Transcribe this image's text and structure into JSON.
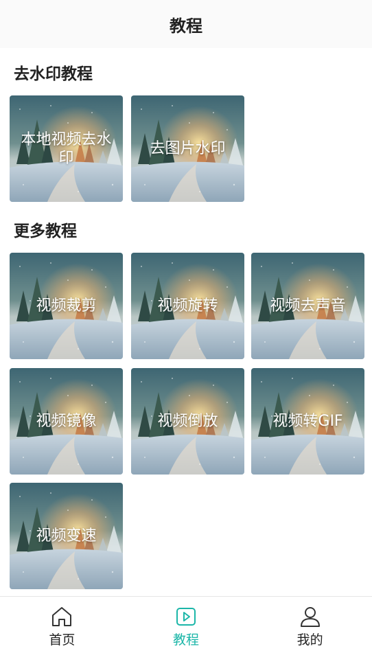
{
  "header": {
    "title": "教程"
  },
  "sections": [
    {
      "title": "去水印教程",
      "items": [
        "本地视频去水印",
        "去图片水印"
      ]
    },
    {
      "title": "更多教程",
      "items": [
        "视频裁剪",
        "视频旋转",
        "视频去声音",
        "视频镜像",
        "视频倒放",
        "视频转GIF",
        "视频变速"
      ]
    }
  ],
  "tabbar": {
    "items": [
      {
        "label": "首页",
        "icon": "home-icon",
        "active": false
      },
      {
        "label": "教程",
        "icon": "play-icon",
        "active": true
      },
      {
        "label": "我的",
        "icon": "user-icon",
        "active": false
      }
    ],
    "active_color": "#1bb6a8"
  }
}
